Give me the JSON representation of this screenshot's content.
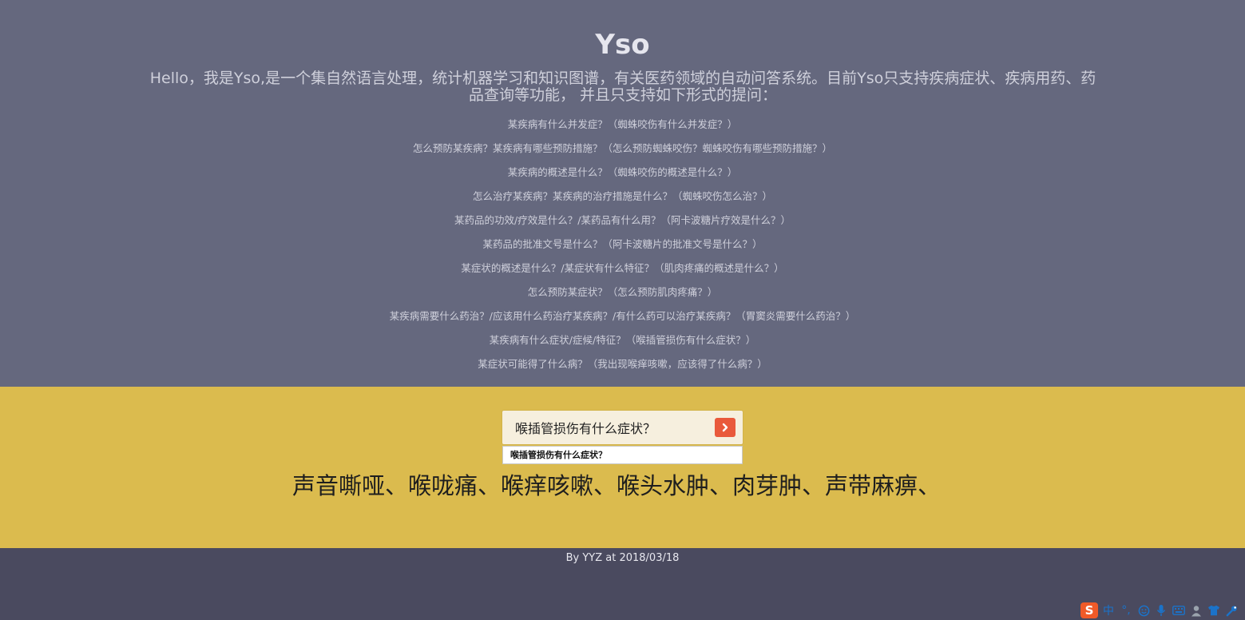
{
  "app": {
    "title": "Yso",
    "intro": "Hello，我是Yso,是一个集自然语言处理，统计机器学习和知识图谱，有关医药领域的自动问答系统。目前Yso只支持疾病症状、疾病用药、药品查询等功能， 并且只支持如下形式的提问："
  },
  "questions": [
    "某疾病有什么并发症？（蜘蛛咬伤有什么并发症？）",
    "怎么预防某疾病？某疾病有哪些预防措施？（怎么预防蜘蛛咬伤？蜘蛛咬伤有哪些预防措施？）",
    "某疾病的概述是什么？（蜘蛛咬伤的概述是什么？）",
    "怎么治疗某疾病？某疾病的治疗措施是什么？（蜘蛛咬伤怎么治？）",
    "某药品的功效/疗效是什么？/某药品有什么用？（阿卡波糖片疗效是什么？）",
    "某药品的批准文号是什么？（阿卡波糖片的批准文号是什么？）",
    "某症状的概述是什么？/某症状有什么特征？（肌肉疼痛的概述是什么？）",
    "怎么预防某症状？（怎么预防肌肉疼痛？）",
    "某疾病需要什么药治？/应该用什么药治疗某疾病？/有什么药可以治疗某疾病？（胃窦炎需要什么药治？）",
    "某疾病有什么症状/症候/特征？（喉插管损伤有什么症状？）",
    "某症状可能得了什么病？（我出现喉痒咳嗽，应该得了什么病？）"
  ],
  "search": {
    "value": "喉插管损伤有什么症状？",
    "suggestion": "喉插管损伤有什么症状？"
  },
  "answer": "声音嘶哑、喉咙痛、喉痒咳嗽、喉头水肿、肉芽肿、声带麻痹、",
  "footer": "By YYZ at 2018/03/18",
  "ime": {
    "logo": "S",
    "mode": "中",
    "punct": "°,"
  },
  "colors": {
    "top_bg": "#65687e",
    "accent_bg": "#dbbb4e",
    "footer_bg": "#4a4a5f",
    "button": "#e9593b"
  },
  "icons": [
    "chevron-right-icon",
    "smiley-icon",
    "microphone-icon",
    "keyboard-icon",
    "user-icon",
    "shirt-icon",
    "wrench-icon"
  ]
}
